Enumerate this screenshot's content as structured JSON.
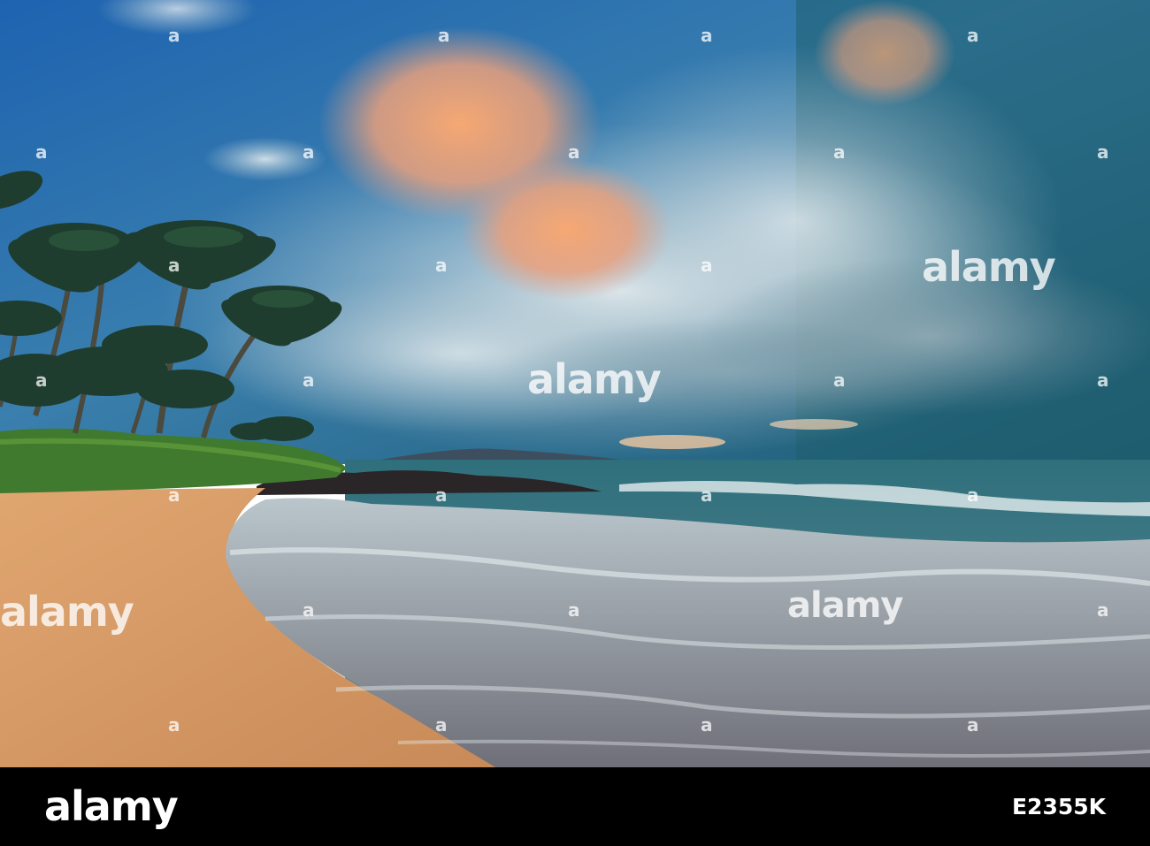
{
  "watermark": {
    "brand": "alamy",
    "glyph": "a"
  },
  "footer": {
    "brand": "alamy",
    "image_id": "E2355K"
  },
  "colors": {
    "footer_bg": "#000000",
    "watermark": "#ffffff"
  }
}
